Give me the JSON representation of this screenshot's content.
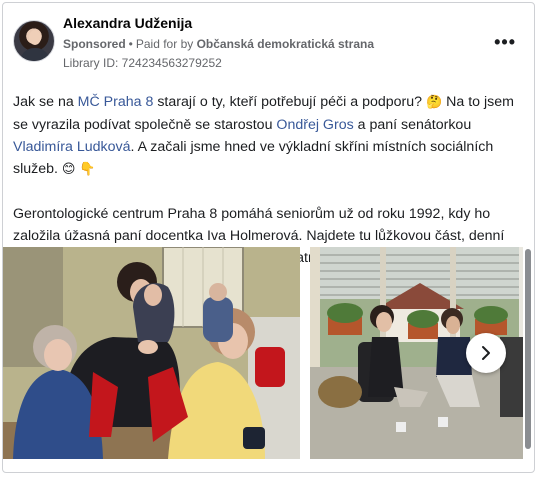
{
  "post": {
    "author": "Alexandra Udženija",
    "sponsored": "Sponsored",
    "bullet": "•",
    "paid_for_prefix": "Paid for by",
    "paid_for_org": "Občanská demokratická strana",
    "library_id": "Library ID: 724234563279252",
    "more_menu": "•••",
    "body": {
      "p1_a": "Jak se na ",
      "p1_link1": "MČ Praha 8",
      "p1_b": " starají o ty, kteří potřebují péči a podporu? ",
      "p1_emoji1": "🤔",
      "p1_c": " Na to jsem se vyrazila podívat společně se starostou ",
      "p1_link2": "Ondřej Gros",
      "p1_d": " a paní senátorkou ",
      "p1_link3": "Vladimíra Ludková",
      "p1_e": ". A začali jsme hned ve výkladní skříni místních sociálních služeb. ",
      "p1_emoji2": "😊",
      "p1_emoji3": "👇",
      "p2": "Gerontologické centrum Praha 8 pomáhá seniorům už od roku 1992, kdy ho založila úžasná paní docentka Iva Holmerová. Najdete tu lůžkovou část, denní stacionář, osobní asistenci, domácí péči, geriatrickou ambulanci, stravování,..."
    }
  },
  "icons": {
    "avatar": "avatar",
    "more": "more-options-icon",
    "next": "chevron-right-icon"
  },
  "colors": {
    "link": "#385898",
    "muted": "#65676b",
    "border": "#ced0d4"
  }
}
